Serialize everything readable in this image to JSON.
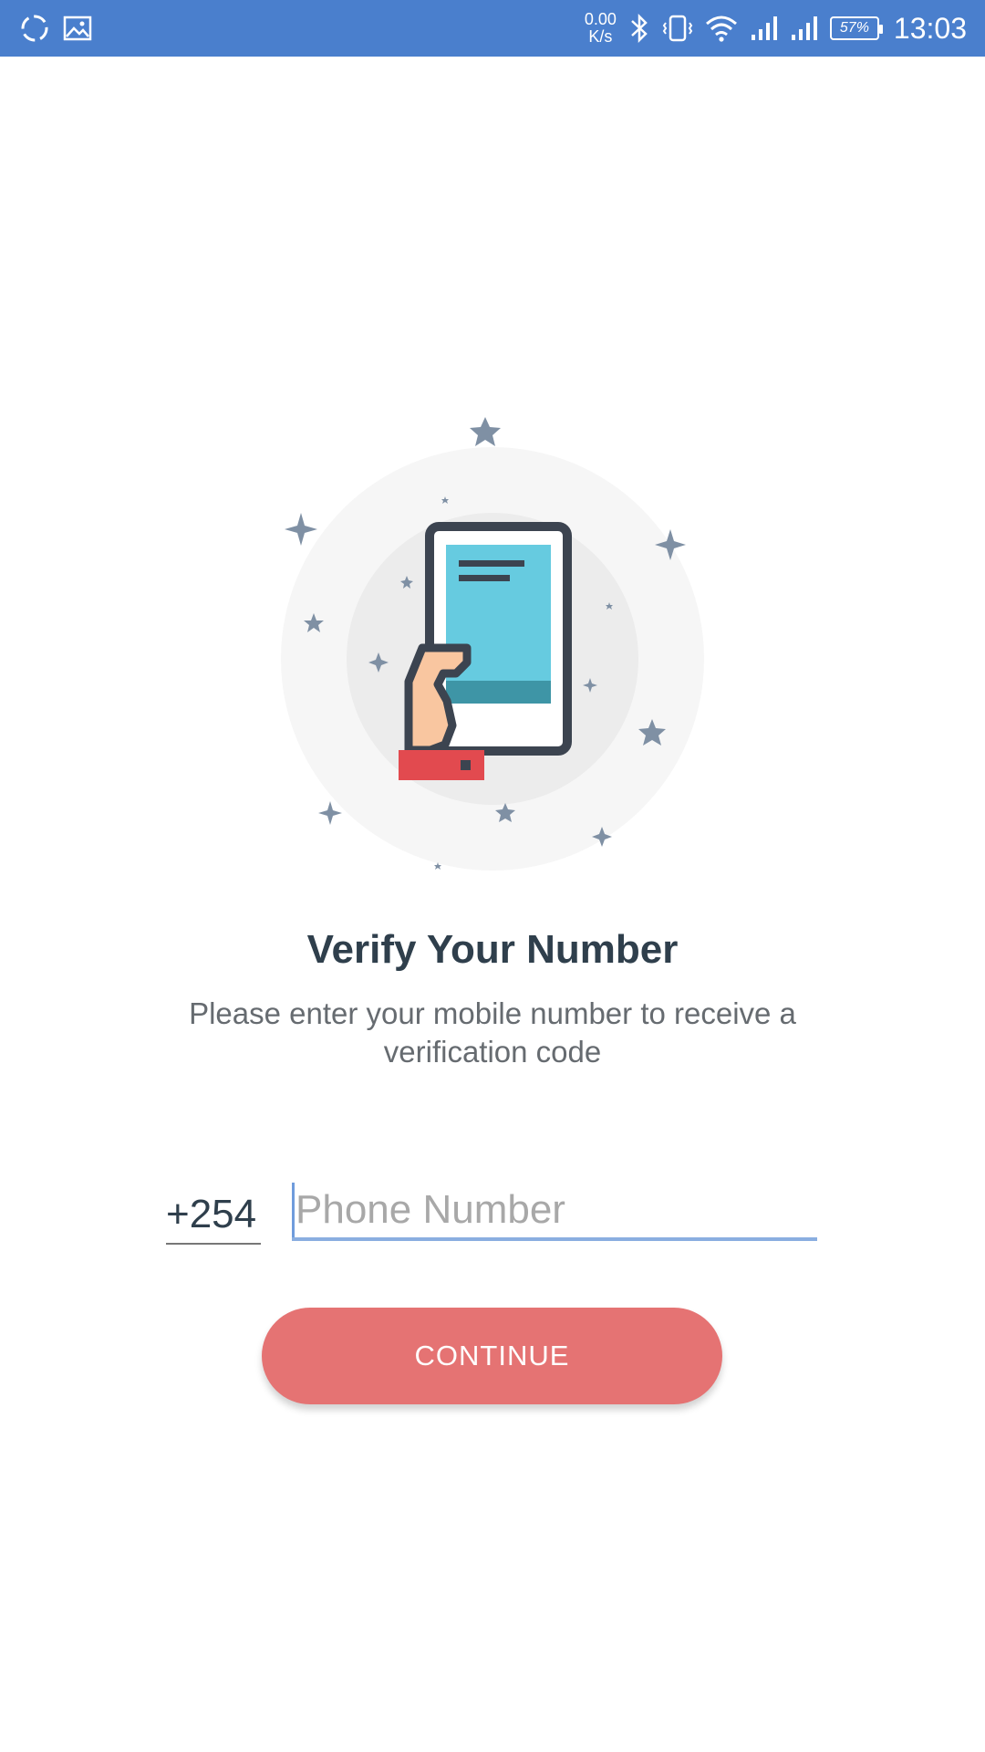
{
  "status_bar": {
    "net_speed_value": "0.00",
    "net_speed_unit": "K/s",
    "battery": "57%",
    "time": "13:03",
    "icons": [
      "sync-icon",
      "gallery-icon",
      "bluetooth-icon",
      "vibrate-icon",
      "wifi-icon",
      "signal-icon",
      "signal-icon",
      "battery-icon"
    ]
  },
  "screen": {
    "title": "Verify Your Number",
    "subtitle": "Please enter your mobile number to receive a verification code",
    "country_code": "+254",
    "phone_placeholder": "Phone Number",
    "phone_value": "",
    "continue_label": "CONTINUE"
  },
  "colors": {
    "status_bar": "#4a7fcd",
    "button": "#e57373",
    "title": "#2f3f4c",
    "input_underline": "#8aaee0"
  }
}
